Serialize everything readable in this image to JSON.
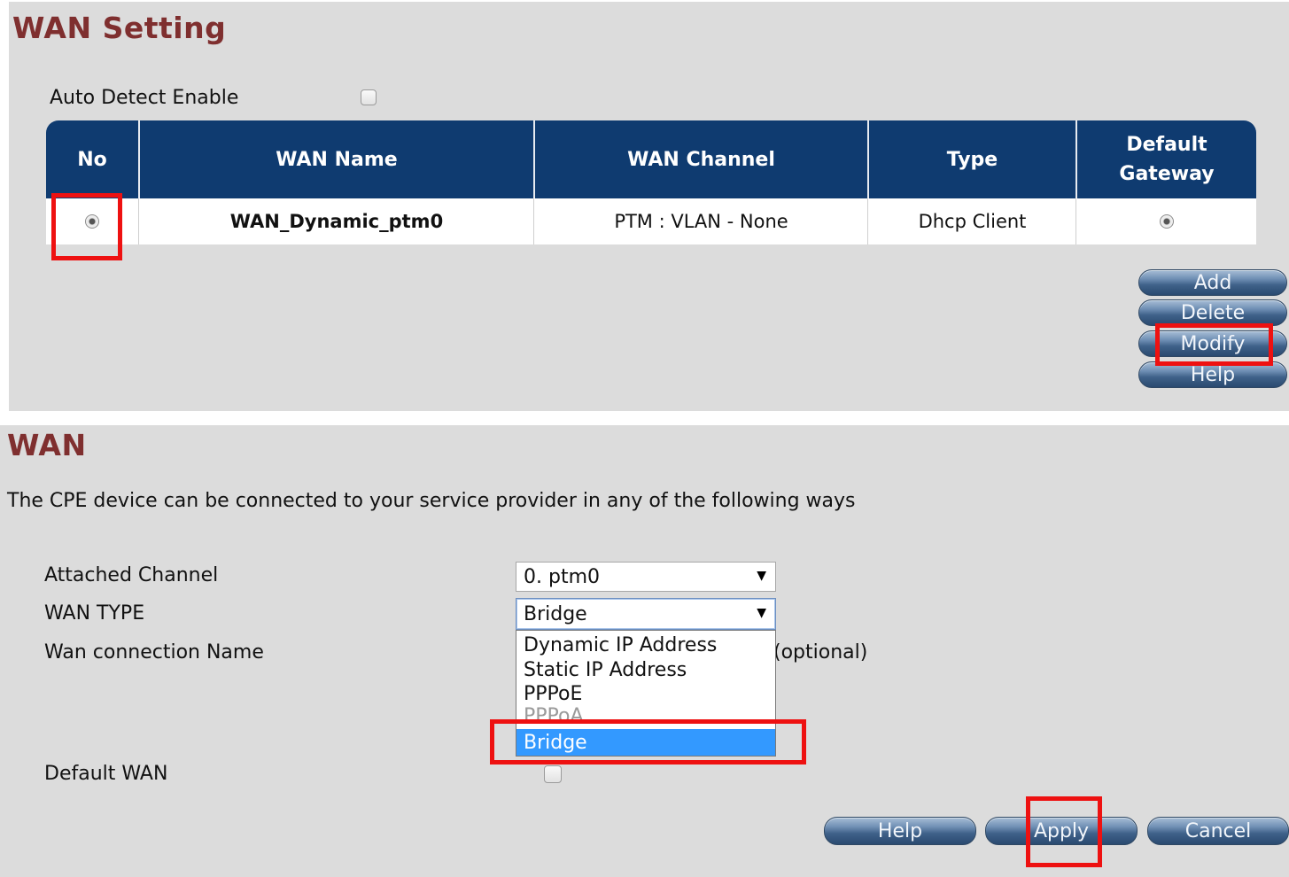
{
  "wan_setting": {
    "title": "WAN Setting",
    "auto_detect_label": "Auto Detect Enable",
    "auto_detect_checked": false,
    "table": {
      "headers": {
        "no": "No",
        "wan_name": "WAN Name",
        "wan_channel": "WAN Channel",
        "type": "Type",
        "default_gateway_line1": "Default",
        "default_gateway_line2": "Gateway"
      },
      "rows": [
        {
          "no_selected": true,
          "wan_name": "WAN_Dynamic_ptm0",
          "wan_channel": "PTM : VLAN - None",
          "type": "Dhcp Client",
          "default_gateway_selected": true
        }
      ]
    },
    "buttons": {
      "add": "Add",
      "delete": "Delete",
      "modify": "Modify",
      "help": "Help"
    }
  },
  "wan": {
    "title": "WAN",
    "description": "The CPE device can be connected to your service provider in any of the following ways",
    "attached_channel_label": "Attached Channel",
    "attached_channel_value": "0. ptm0",
    "wan_type_label": "WAN TYPE",
    "wan_type_value": "Bridge",
    "wan_type_options": [
      "Dynamic IP Address",
      "Static IP Address",
      "PPPoE",
      "PPPoA",
      "Bridge"
    ],
    "wan_type_highlighted": "Bridge",
    "connection_name_label": "Wan connection Name",
    "optional_text": "(optional)",
    "default_wan_label": "Default WAN",
    "default_wan_checked": false,
    "buttons": {
      "help": "Help",
      "apply": "Apply",
      "cancel": "Cancel"
    }
  },
  "colors": {
    "title": "#7f2f2f",
    "table_header": "#0f3b70",
    "highlight": "#3399ff",
    "annotation_box": "#ee1111"
  }
}
